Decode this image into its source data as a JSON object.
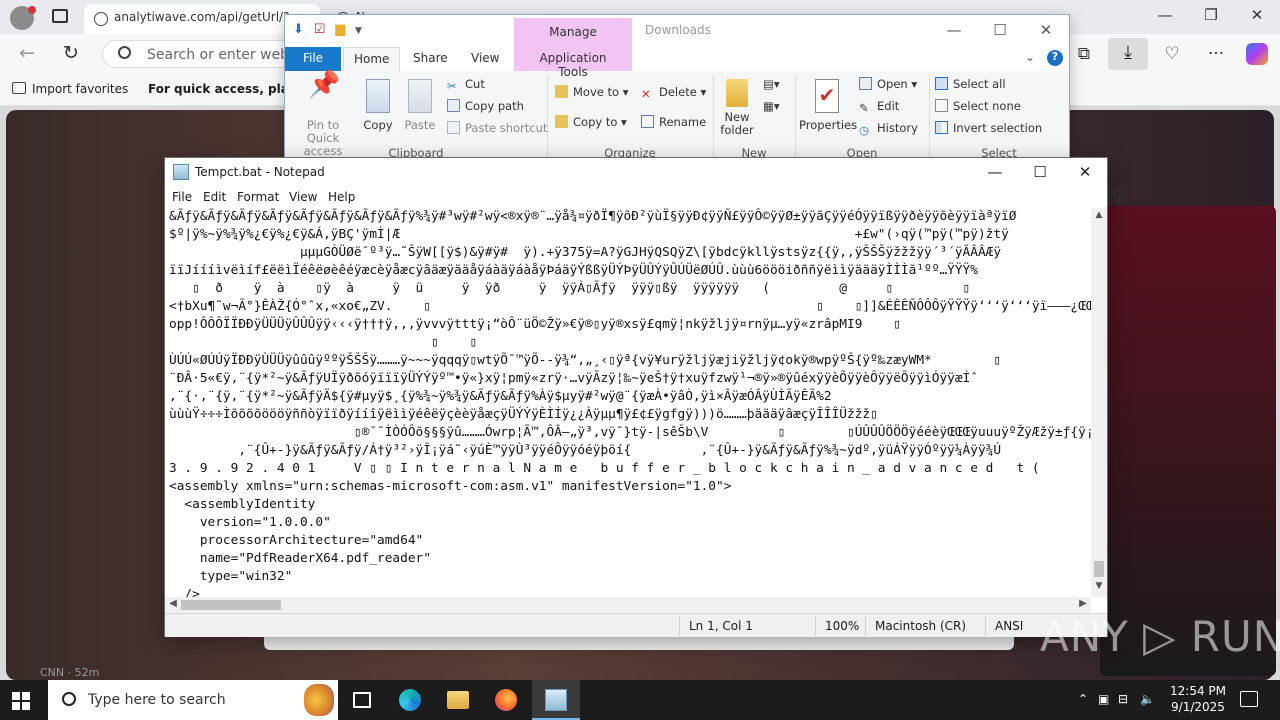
{
  "browser": {
    "tabs": [
      {
        "label": "analytiwave.com/api/getUrl/?w"
      },
      {
        "label": "Ne..."
      }
    ],
    "address": "analytiwave.com/api/getUrl/?w",
    "search_placeholder": "Search or enter web a",
    "favorites": {
      "import_label": "Import favorites",
      "hint": "For quick access, place y"
    },
    "news_source": "CNN · 52m"
  },
  "explorer": {
    "title": "Downloads",
    "manage_tab": "Manage",
    "tabs": [
      "File",
      "Home",
      "Share",
      "View",
      "Application Tools"
    ],
    "ribbon": {
      "pin_label": "Pin to Quick access",
      "copy_label": "Copy",
      "paste_label": "Paste",
      "cut_label": "Cut",
      "copy_path_label": "Copy path",
      "paste_shortcut_label": "Paste shortcut",
      "move_to_label": "Move to",
      "copy_to_label": "Copy to",
      "delete_label": "Delete",
      "rename_label": "Rename",
      "new_folder_label": "New folder",
      "properties_label": "Properties",
      "open_label": "Open",
      "edit_label": "Edit",
      "history_label": "History",
      "select_all_label": "Select all",
      "select_none_label": "Select none",
      "invert_selection_label": "Invert selection",
      "groups": [
        "Clipboard",
        "Organize",
        "New",
        "Open",
        "Select"
      ]
    }
  },
  "notepad": {
    "title": "Tempct.bat - Notepad",
    "menu": [
      "File",
      "Edit",
      "Format",
      "View",
      "Help"
    ],
    "lines": [
      "&Ãƒÿ&Ãƒÿ&Ãƒÿ&Ãƒÿ&Ãƒÿ&Ãƒÿ&Ãƒÿ&Ãƒÿ%¾ÿ#³wÿ#²wÿ<®xÿ®¨…ÿå¾¤ÿðÏ¶ÿõÐ²ÿùÏ§ÿÿÐ¢ÿÿÑ£ÿÿÔ©ÿÿØ±ÿÿãÇÿÿéÓÿÿïßÿÿðèÿÿõèÿÿïàªÿïØ",
      "$º|ÿ%~ÿ%¾ÿ%¿€ÿ%¿€ÿ&Á,ÿBÇ'ÿmÌ|Æ                                                           +£w\"(›qÿ(™pÿ(™pÿ)žtÿ",
      "                 µµµGÒÜØë¯º³ÿ…˜ŠÿW[[ÿ$)&ÿ#ÿ#  ÿ).+ÿ375ÿ=A?ÿGJHÿQSQÿZ\\[ÿbdcÿkllÿstsÿz{{ÿ,,ÿŠŠŠÿžžžÿÿ´³´ÿÃÂÂÆÿ",
      "ïïJíííìvëìíf£ëëìÏéêëøèêéÿæcèÿåæcÿâäæÿääåÿáàäÿáàåÿÞáäÿÝßßÿÜÝÞÿÜÛÝÿÛÚÜëØÚÛ.ùùù6öööiðññÿëììÿäääÿÌÌÌã¹ºº…ŸŸŸ%",
      "   ▯  ð    ÿ  à    ▯ÿ  à     ÿ  ü     ÿ  ÿð     ÿ  ÿÿÀ▯Ãƒÿ  ÿÿÿ▯ßÿ  ÿÿÿÿÿÿ   (         @     ▯         ▯",
      "<†bXu¶˜w¬Ã°}ÊÀŽ{Ó°ˆx‚«xo€„ZV.    ▯                                                  ▯    ▯]]&ÉÊÊÑÔÔÔÿŸŸŸÿ‘‘‘ÿ‘‘‘ÿï———¿ŒŒdddc▯▯▯CkQŀ",
      "opp!ÔÔÔÏÏÐÐÿÜÜÜÿÛÛÛÿÿ‹‹‹ÿ†††ÿ,,,ÿvvvÿtttÿ¡“òÔ¨üÖ©Žÿ»€ÿ®▯yÿ®xsÿ£qmÿ¦nkÿžljÿ¤rnÿµ…yÿ«zrâpMI9    ▯",
      "                                  ▯    ▯",
      "ÙÚÚ«ØÚÚÿÏÐÐÿÙÜÜÿûûûÿººÿŠŠŠÿ………ÿ~~~ÿqqqÿ▯wtÿÕ¯™ÿÕ‑‑ÿ¾“,„¸‹▯ÿª{vÿ¥urÿžljÿæjiÿžljÿ¢okÿ®wpÿºŠ{ÿº‰zæyWM*        ▯",
      "¨ÐÂ·5«€ÿ,¨{ÿ*²~ÿ&ÃƒÿUÏÿðõóÿïïïÿÜÝÝÿº™•ÿ«}xÿ¦pmÿ«zrÿ·…vÿÃzÿ¦‰~ÿeŠ†ÿ†xuÿfzwÿ¹¬®ÿ»®ÿûéxÿÿèÕÿÿèÔÿÿëÕÿÿìÓÿÿæÍˆ",
      ",¨{·,¨{ÿ,¨{ÿ*²~ÿ&ÃƒÿÄ${ÿ#µyÿ$¸{ÿ%¾~ÿ%¾ÿ&Ãƒÿ&Ãƒÿ%Àÿ$µyÿ#²wÿ@¨{ÿæÀ•ÿâÒ‚ÿì×ÂÿæÓÂÿÙÌÃÿÊÃ%2",
      "ùùùŸ÷÷÷ÌõõõõöööÿññòÿïïðÿííîÿëììÿéêëÿçèèÿåæçÿÜÝÝÿÈÌÍÿ¿¿Àÿµµ¶ÿ£¢£ÿgfgÿ)))ö………þäääÿâæçÿÎÎÎÜžžž▯",
      "                        ▯®¯¯ÌÒÓÔõ§§§ÿû………Ówrp¦Ã™,ÔÂ–„ÿ³‚vÿ¯}tÿ-|sêŠb\\V         ▯        ▯ÚÛÛÛÖÖÖÿééèÿŒŒŒÿuuuÿºŽÿÆžÿ±ƒ{ÿ¡p",
      "         ,¨{Û+-}ÿ&Ãƒÿ&Ãƒÿ/Á†ÿ³²›ÿÎ¡ÿá˜‹ÿúÈ™ÿÿÙ³ÿÿéÔÿÿóéÿþöí{         ,¨{Û+-}ÿ&Ãƒÿ&Ãƒÿ%¾~ÿdº,ÿüÁŸÿÿÓºÿÿ¼Àÿÿ¾Ú",
      "3 . 9 . 9 2 . 4 0 1     V ▯ ▯ I n t e r n a l N a m e   b u f f e r _ b l o c k c h a i n _ a d v a n c e d   t (",
      "<assembly xmlns=\"urn:schemas-microsoft-com:asm.v1\" manifestVersion=\"1.0\">",
      "  <assemblyIdentity",
      "    version=\"1.0.0.0\"",
      "    processorArchitecture=\"amd64\"",
      "    name=\"PdfReaderX64.pdf_reader\"",
      "    type=\"win32\"",
      "  />"
    ],
    "status": {
      "position": "Ln 1, Col 1",
      "zoom": "100%",
      "line_ending": "Macintosh (CR)",
      "encoding": "ANSI"
    }
  },
  "watermark": "ANY ▷ RUN",
  "taskbar": {
    "search_placeholder": "Type here to search",
    "time": "12:54 PM",
    "date": "9/1/2025"
  }
}
